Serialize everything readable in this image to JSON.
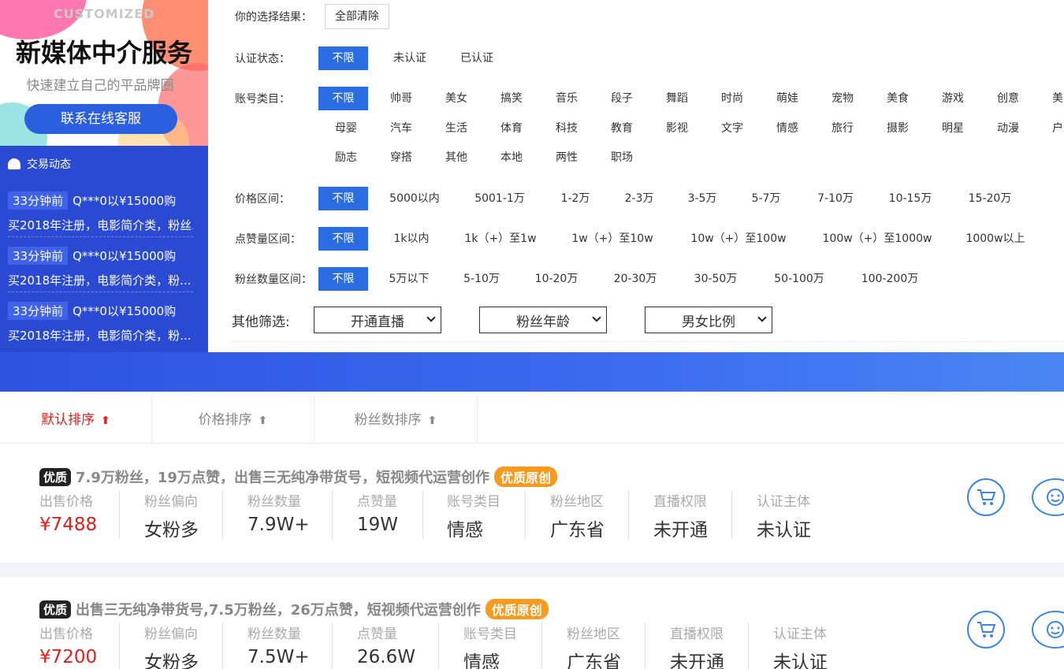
{
  "banner": {
    "customized": "CUSTOMIZED",
    "title": "新媒体中介服务",
    "subtitle": "快速建立自己的平品牌圈",
    "contact_button": "联系在线客服"
  },
  "feed": {
    "title": "交易动态",
    "items": [
      {
        "time": "33分钟前",
        "text1": "Q***0以¥15000购",
        "text2": "买2018年注册，电影简介类，粉丝..."
      },
      {
        "time": "33分钟前",
        "text1": "Q***0以¥15000购",
        "text2": "买2018年注册，电影简介类，粉..."
      },
      {
        "time": "33分钟前",
        "text1": "Q***0以¥15000购",
        "text2": "买2018年注册，电影简介类，粉..."
      }
    ]
  },
  "filters": {
    "selection_label": "你的选择结果：",
    "clear_all": "全部清除",
    "auth_label": "认证状态：",
    "auth_options": [
      "不限",
      "未认证",
      "已认证"
    ],
    "category_label": "账号类目：",
    "category_row1": [
      "不限",
      "帅哥",
      "美女",
      "搞笑",
      "音乐",
      "段子",
      "舞蹈",
      "时尚",
      "萌娃",
      "宠物",
      "美食",
      "游戏",
      "创意",
      "美妆"
    ],
    "category_row2": [
      "母婴",
      "汽车",
      "生活",
      "体育",
      "科技",
      "教育",
      "影视",
      "文字",
      "情感",
      "旅行",
      "摄影",
      "明星",
      "动漫",
      "户外"
    ],
    "category_row3": [
      "励志",
      "穿搭",
      "其他",
      "本地",
      "两性",
      "职场"
    ],
    "price_label": "价格区间：",
    "price_options": [
      "不限",
      "5000以内",
      "5001-1万",
      "1-2万",
      "2-3万",
      "3-5万",
      "5-7万",
      "7-10万",
      "10-15万",
      "15-20万"
    ],
    "likes_label": "点赞量区间：",
    "likes_options": [
      "不限",
      "1k以内",
      "1k（+）至1w",
      "1w（+）至10w",
      "10w（+）至100w",
      "100w（+）至1000w",
      "1000w以上"
    ],
    "fans_label": "粉丝数量区间：",
    "fans_options": [
      "不限",
      "5万以下",
      "5-10万",
      "10-20万",
      "20-30万",
      "30-50万",
      "50-100万",
      "100-200万"
    ],
    "other_label": "其他筛选:",
    "selects": [
      "开通直播",
      "粉丝年龄",
      "男女比例"
    ]
  },
  "sort": {
    "default": "默认排序",
    "price": "价格排序",
    "fans": "粉丝数排序",
    "arrow": "⬆"
  },
  "listings": [
    {
      "badge": "优质",
      "title": "7.9万粉丝，19万点赞，出售三无纯净带货号，短视频代运营创作",
      "tag": "优质原创",
      "stats": [
        {
          "k": "出售价格",
          "v": "¥7488"
        },
        {
          "k": "粉丝偏向",
          "v": "女粉多"
        },
        {
          "k": "粉丝数量",
          "v": "7.9W+"
        },
        {
          "k": "点赞量",
          "v": "19W"
        },
        {
          "k": "账号类目",
          "v": "情感"
        },
        {
          "k": "粉丝地区",
          "v": "广东省"
        },
        {
          "k": "直播权限",
          "v": "未开通"
        },
        {
          "k": "认证主体",
          "v": "未认证"
        }
      ]
    },
    {
      "badge": "优质",
      "title": "出售三无纯净带货号,7.5万粉丝，26万点赞，短视频代运营创作",
      "tag": "优质原创",
      "stats": [
        {
          "k": "出售价格",
          "v": "¥7200"
        },
        {
          "k": "粉丝偏向",
          "v": "女粉多"
        },
        {
          "k": "粉丝数量",
          "v": "7.5W+"
        },
        {
          "k": "点赞量",
          "v": "26.6W"
        },
        {
          "k": "账号类目",
          "v": "情感"
        },
        {
          "k": "粉丝地区",
          "v": "广东省"
        },
        {
          "k": "直播权限",
          "v": "未开通"
        },
        {
          "k": "认证主体",
          "v": "未认证"
        }
      ]
    }
  ],
  "colors": {
    "accent": "#2a6de3",
    "price": "#e0201d",
    "feed_bg": "#2a4ad4",
    "tag": "#f79a1d"
  },
  "icons": [
    "bell-icon",
    "chevron-down-icon",
    "cart-icon",
    "service-icon",
    "arrow-up-icon"
  ]
}
